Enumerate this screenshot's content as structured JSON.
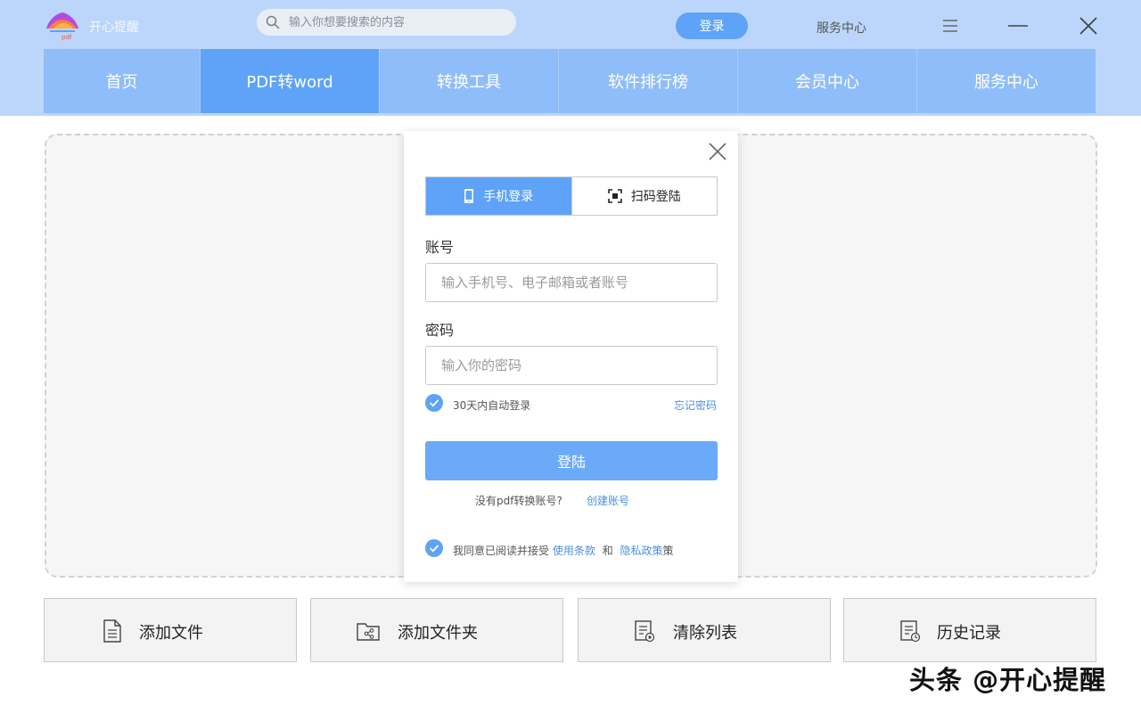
{
  "app": {
    "title": "开心提醒",
    "logo_text": "pdf"
  },
  "search": {
    "placeholder": "输入你想要搜索的内容"
  },
  "header": {
    "login_label": "登录",
    "service_label": "服务中心"
  },
  "nav": {
    "tabs": [
      {
        "label": "首页"
      },
      {
        "label": "PDF转word",
        "active": true
      },
      {
        "label": "转换工具"
      },
      {
        "label": "软件排行榜"
      },
      {
        "label": "会员中心"
      },
      {
        "label": "服务中心"
      }
    ]
  },
  "modal": {
    "tabs": [
      {
        "label": "手机登录",
        "icon": "phone-icon",
        "active": true
      },
      {
        "label": "扫码登陆",
        "icon": "qr-scan-icon"
      }
    ],
    "account_label": "账号",
    "account_placeholder": "输入手机号、电子邮箱或者账号",
    "password_label": "密码",
    "password_placeholder": "输入你的密码",
    "remember_label": "30天内自动登录",
    "forgot_label": "忘记密码",
    "submit_label": "登陆",
    "no_account_text": "没有pdf转换账号?",
    "create_account_label": "创建账号",
    "agree_prefix": "我同意已阅读并接受",
    "terms_label": "使用条款",
    "and_text": "和",
    "privacy_label": "隐私政策",
    "privacy_suffix": "策"
  },
  "actions": [
    {
      "label": "添加文件",
      "icon": "file-icon"
    },
    {
      "label": "添加文件夹",
      "icon": "folder-share-icon"
    },
    {
      "label": "清除列表",
      "icon": "clear-list-icon"
    },
    {
      "label": "历史记录",
      "icon": "history-icon"
    }
  ],
  "watermark": "头条 @开心提醒",
  "colors": {
    "accent": "#5ea3f7",
    "header_bg": "#bcd6fb",
    "nav_bg": "#8fbdfa",
    "link": "#4a90e2"
  }
}
